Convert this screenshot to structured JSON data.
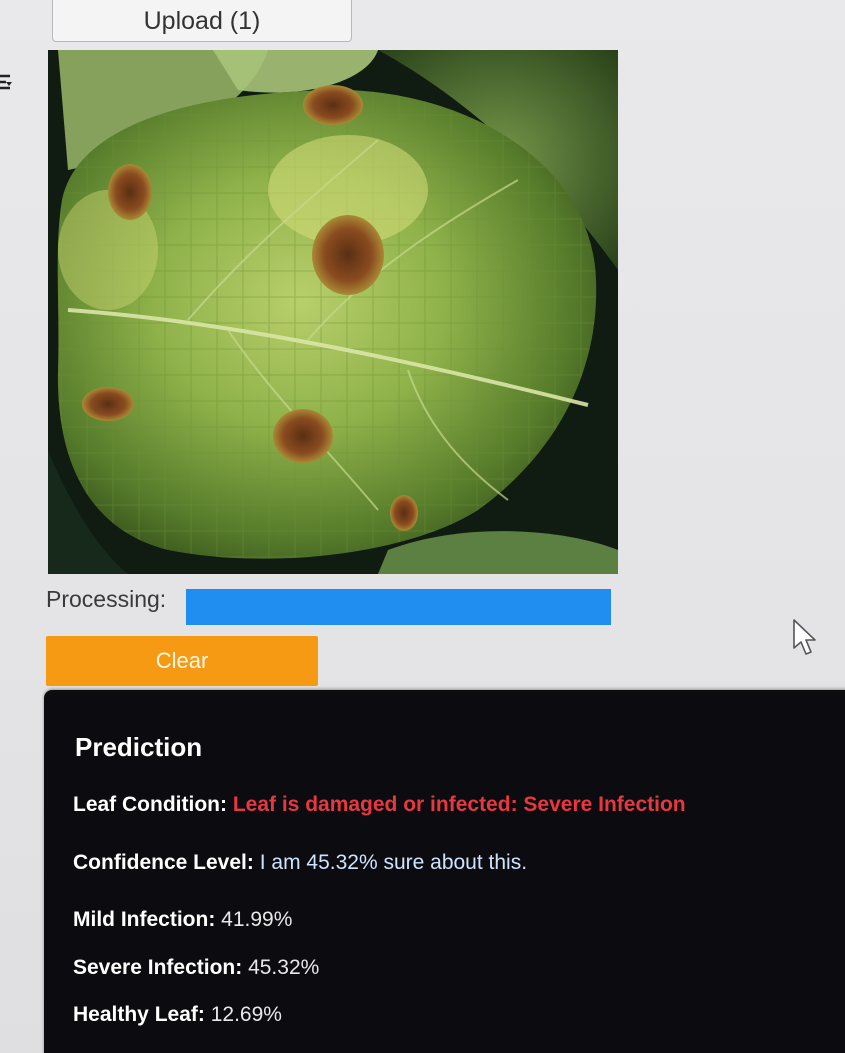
{
  "upload": {
    "label": "Upload (1)"
  },
  "side_icon": "menu-toggle-icon",
  "image": {
    "description_icon": "leaf-photo"
  },
  "processing": {
    "label": "Processing:",
    "progress": 1.0,
    "color": "#1f8ef0"
  },
  "clear": {
    "label": "Clear",
    "color": "#f59a12"
  },
  "prediction": {
    "title": "Prediction",
    "condition_label": "Leaf Condition:",
    "condition_value": "Leaf is damaged or infected: Severe Infection",
    "confidence_label": "Confidence Level:",
    "confidence_value": "I am 45.32% sure about this.",
    "results": [
      {
        "label": "Mild Infection:",
        "value": "41.99%"
      },
      {
        "label": "Severe Infection:",
        "value": "45.32%"
      },
      {
        "label": "Healthy Leaf:",
        "value": "12.69%"
      }
    ]
  },
  "colors": {
    "danger": "#e8373f",
    "panel_bg": "#0c0c10"
  }
}
